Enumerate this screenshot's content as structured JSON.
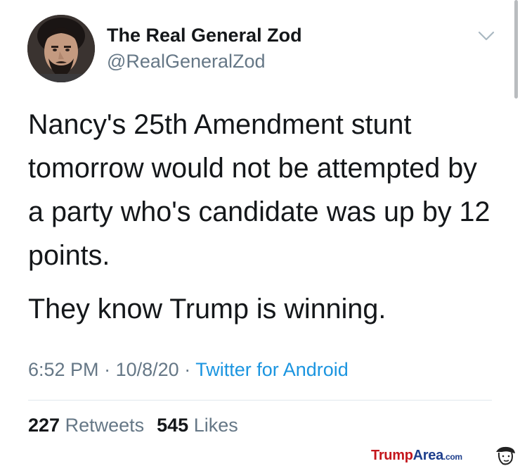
{
  "tweet": {
    "author_name": "The Real General Zod",
    "author_handle": "@RealGeneralZod",
    "text_paragraphs": [
      "Nancy's 25th Amendment stunt tomorrow would not be attempted by a party who's candidate was up by 12 points.",
      "They know Trump is winning."
    ],
    "time": "6:52 PM",
    "date": "10/8/20",
    "separator": "·",
    "source": "Twitter for Android",
    "retweets_count": "227",
    "retweets_label": "Retweets",
    "likes_count": "545",
    "likes_label": "Likes"
  },
  "icons": {
    "menu": "chevron-down-icon",
    "avatar": "avatar-image"
  },
  "watermark": {
    "part1": "Trump",
    "part2": "Area",
    "part3": ".com"
  },
  "colors": {
    "text": "#14171a",
    "secondary": "#657786",
    "link": "#1b95e0",
    "divider": "#e1e8ed",
    "watermark_red": "#c4161c",
    "watermark_blue": "#1d3e8c"
  }
}
